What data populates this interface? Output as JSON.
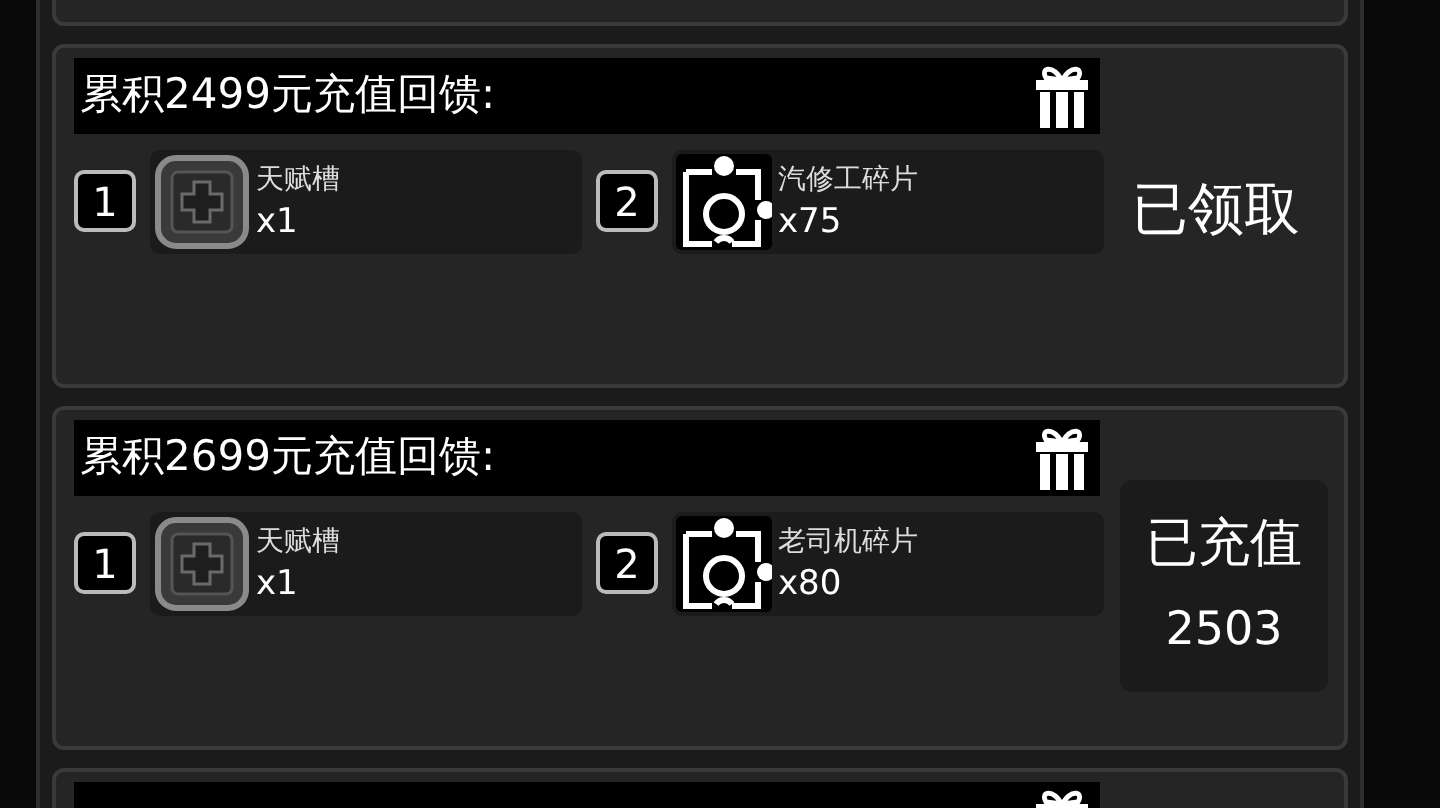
{
  "tiers": [
    {
      "title": "累积2499元充值回馈:",
      "rewards": [
        {
          "index": "1",
          "kind": "slot",
          "name": "天赋槽",
          "count": "x1"
        },
        {
          "index": "2",
          "kind": "fragment",
          "name": "汽修工碎片",
          "count": "x75"
        }
      ],
      "status": {
        "kind": "claimed",
        "label": "已领取"
      }
    },
    {
      "title": "累积2699元充值回馈:",
      "rewards": [
        {
          "index": "1",
          "kind": "slot",
          "name": "天赋槽",
          "count": "x1"
        },
        {
          "index": "2",
          "kind": "fragment",
          "name": "老司机碎片",
          "count": "x80"
        }
      ],
      "status": {
        "kind": "progress",
        "label": "已充值",
        "amount": "2503"
      }
    }
  ]
}
